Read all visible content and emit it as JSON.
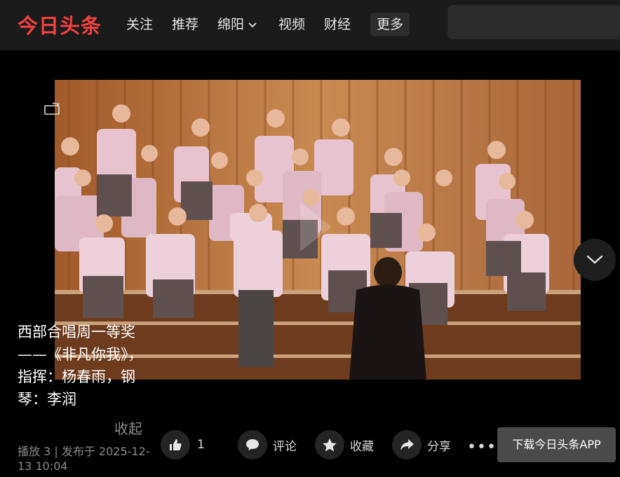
{
  "header": {
    "logo": "今日头条",
    "nav": [
      "关注",
      "推荐",
      "绵阳",
      "视频",
      "财经",
      "更多"
    ]
  },
  "video": {
    "title": "西部合唱周一等奖——《非凡你我》，指挥：杨春雨，钢琴：李润",
    "collapse_label": "收起",
    "meta": "播放 3 | 发布于 2025-12-13 10:04"
  },
  "actions": {
    "like_count": "1",
    "comment_label": "评论",
    "favorite_label": "收藏",
    "share_label": "分享",
    "more_label": "•••",
    "download_label": "下载今日头条APP"
  },
  "colors": {
    "logo": "#f04142",
    "header_bg": "#1b1b1b",
    "page_bg": "#000000"
  }
}
